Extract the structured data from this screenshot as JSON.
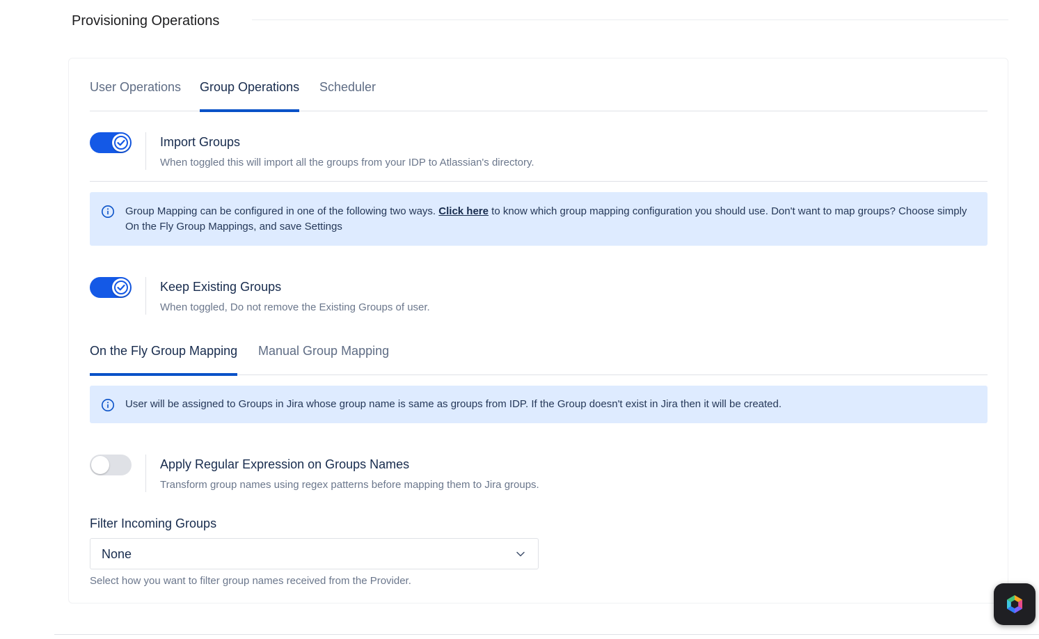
{
  "section": {
    "title": "Provisioning Operations"
  },
  "tabs": [
    {
      "label": "User Operations",
      "active": false
    },
    {
      "label": "Group Operations",
      "active": true
    },
    {
      "label": "Scheduler",
      "active": false
    }
  ],
  "import_groups": {
    "enabled": true,
    "title": "Import Groups",
    "description": "When toggled this will import all the groups from your IDP to Atlassian's directory."
  },
  "mapping_info": {
    "icon": "info-icon",
    "text_before": "Group Mapping can be configured in one of the following two ways. ",
    "link_label": "Click here",
    "text_after": " to know which group mapping configuration you should use. Don't want to map groups? Choose simply On the Fly Group Mappings, and save Settings"
  },
  "keep_existing_groups": {
    "enabled": true,
    "title": "Keep Existing Groups",
    "description": "When toggled, Do not remove the Existing Groups of user."
  },
  "mapping_tabs": [
    {
      "label": "On the Fly Group Mapping",
      "active": true
    },
    {
      "label": "Manual Group Mapping",
      "active": false
    }
  ],
  "onthefly_info": {
    "icon": "info-icon",
    "text": "User will be assigned to Groups in Jira whose group name is same as groups from IDP. If the Group doesn't exist in Jira then it will be created."
  },
  "regex_toggle": {
    "enabled": false,
    "title": "Apply Regular Expression on Groups Names",
    "description": "Transform group names using regex patterns before mapping them to Jira groups."
  },
  "filter_incoming_groups": {
    "label": "Filter Incoming Groups",
    "selected": "None",
    "help": "Select how you want to filter group names received from the Provider."
  },
  "colors": {
    "accent": "#0a52c8",
    "toggle_on": "#1459e6",
    "info_bg": "#deebff"
  },
  "widget": {
    "icon": "assistant-logo-icon"
  }
}
